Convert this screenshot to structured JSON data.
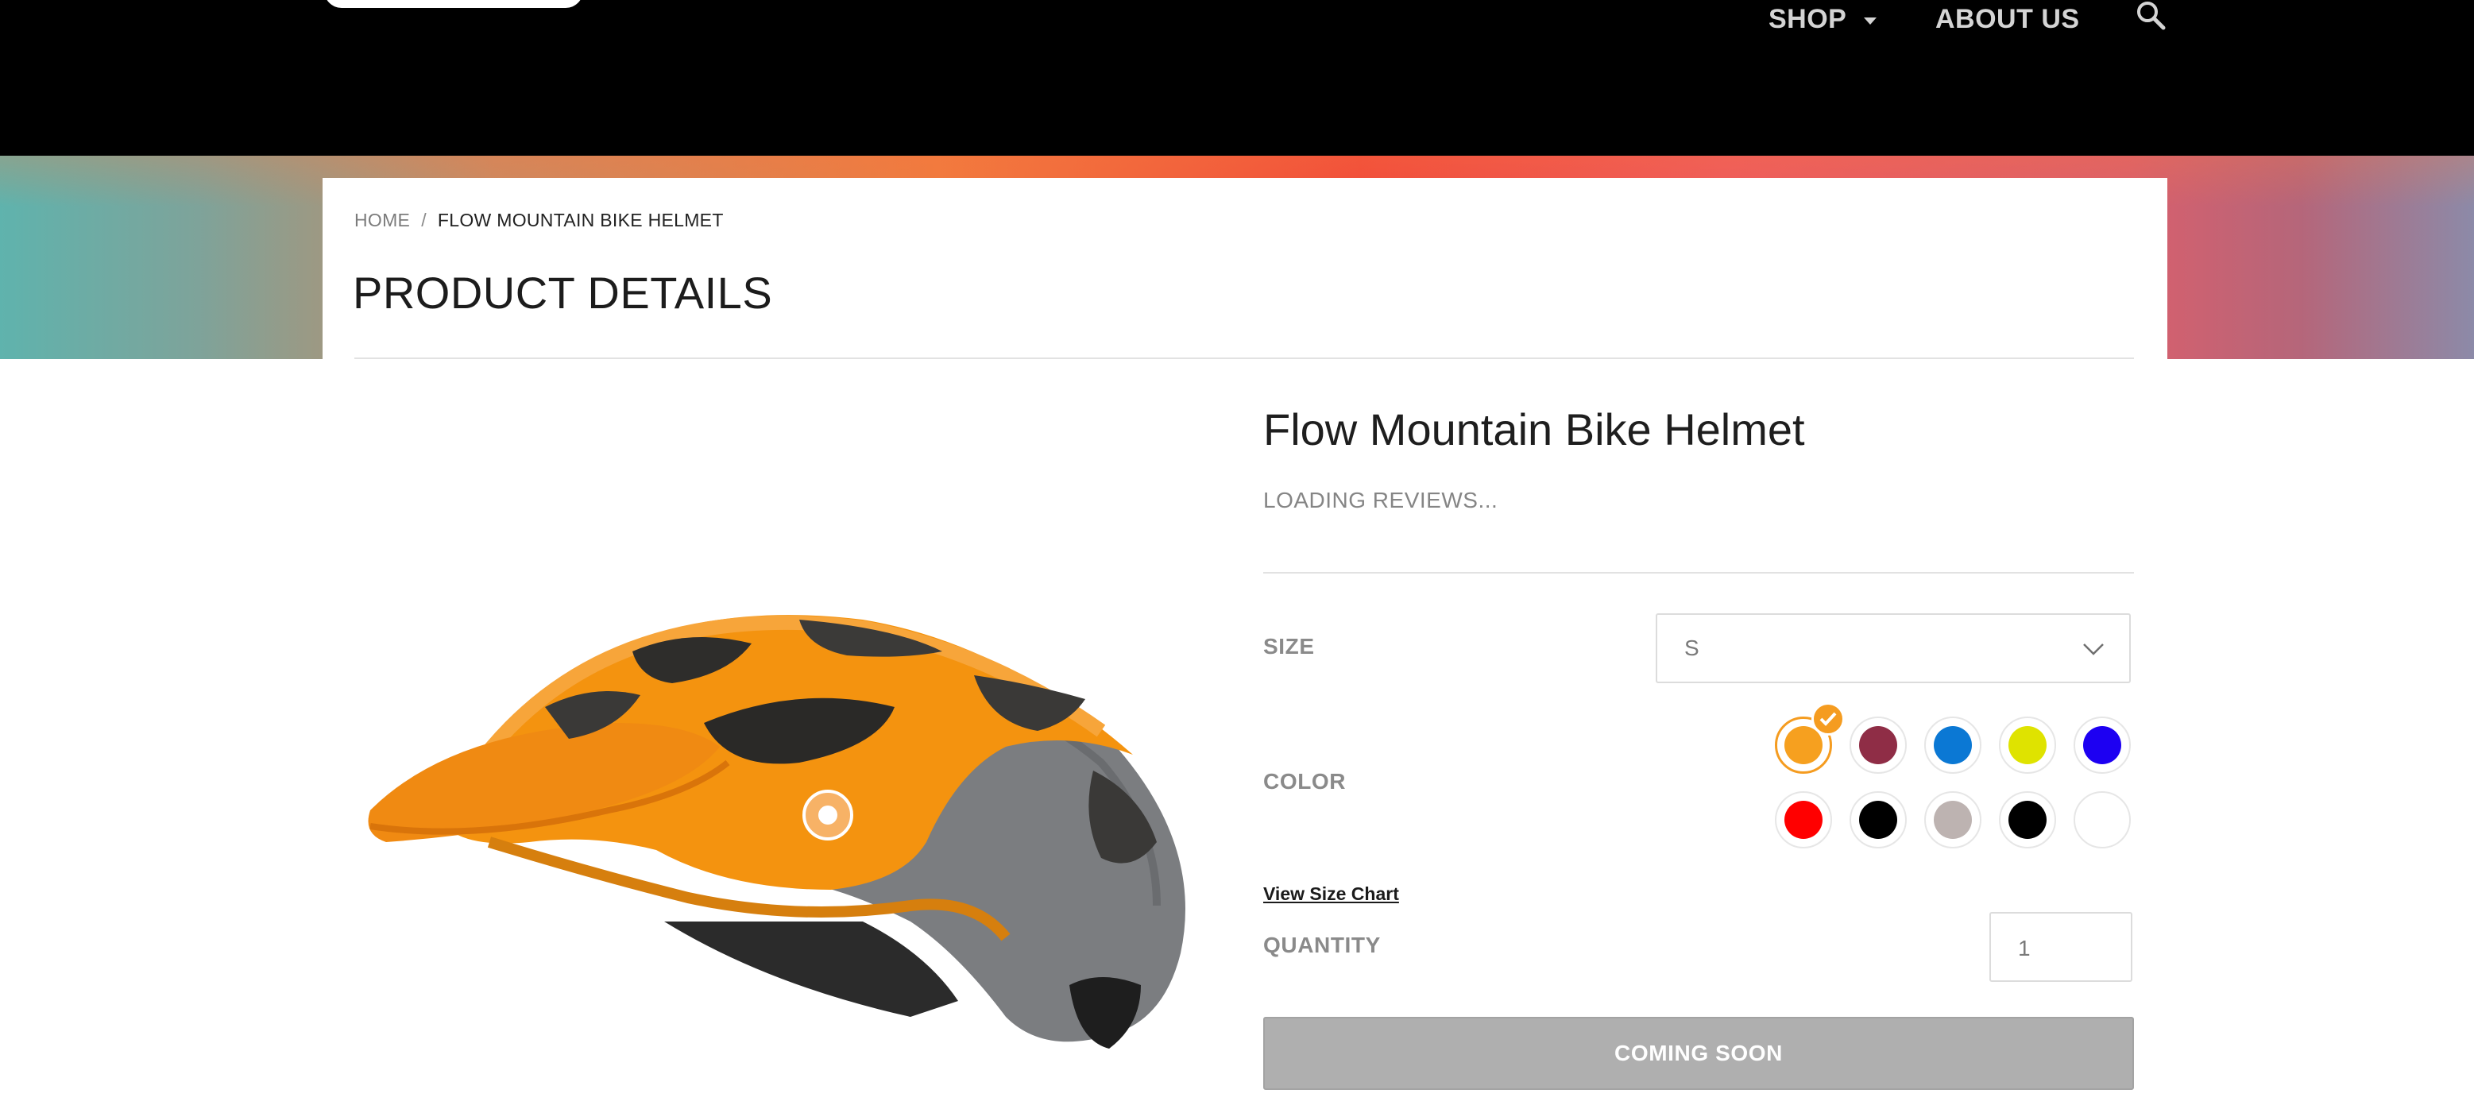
{
  "header": {
    "nav": {
      "shop_label": "SHOP",
      "about_label": "ABOUT US"
    },
    "icons": {
      "caret": "chevron-down-icon",
      "search": "search-icon"
    }
  },
  "breadcrumb": {
    "home": "HOME",
    "separator": "/",
    "current": "FLOW MOUNTAIN BIKE HELMET"
  },
  "page_title": "PRODUCT DETAILS",
  "product": {
    "name": "Flow Mountain Bike Helmet",
    "reviews_status": "LOADING REVIEWS...",
    "size": {
      "label": "SIZE",
      "selected": "S"
    },
    "color": {
      "label": "COLOR",
      "selected_index": 0,
      "swatches": [
        "#f6a01f",
        "#8f2d46",
        "#0b78d4",
        "#dfe300",
        "#1d00f2",
        "#ff0000",
        "#000000",
        "#bdb3b1",
        "#000000",
        "#ffffff"
      ]
    },
    "size_chart_link": "View Size Chart",
    "quantity": {
      "label": "QUANTITY",
      "value": "1"
    },
    "cta": "COMING SOON"
  },
  "colors": {
    "header_bg": "#000000",
    "accent_selected": "#f59c20",
    "disabled_button": "#afafaf"
  }
}
